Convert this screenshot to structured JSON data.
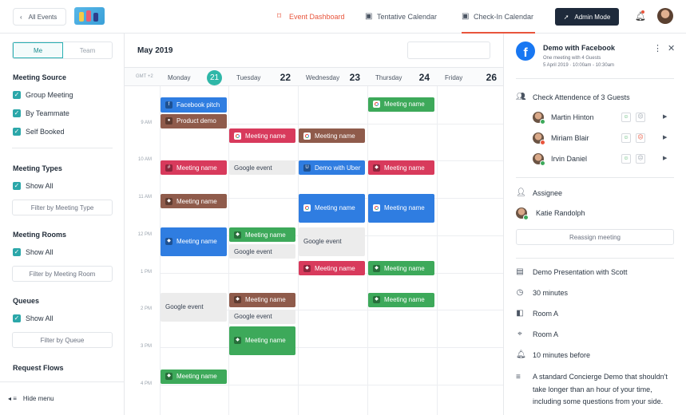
{
  "topbar": {
    "back_label": "All Events",
    "nav": [
      {
        "label": "Event Dashboard",
        "icon": "tag-icon"
      },
      {
        "label": "Tentative Calendar",
        "icon": "calendar-question-icon"
      },
      {
        "label": "Check-In Calendar",
        "icon": "calendar-check-icon"
      }
    ],
    "admin_label": "Admin Mode"
  },
  "sidebar": {
    "toggle": {
      "me": "Me",
      "team": "Team"
    },
    "meeting_source": {
      "title": "Meeting Source",
      "options": [
        "Group Meeting",
        "By Teammate",
        "Self Booked"
      ]
    },
    "meeting_types": {
      "title": "Meeting Types",
      "show_all": "Show All",
      "filter": "Filter by Meeting Type"
    },
    "meeting_rooms": {
      "title": "Meeting Rooms",
      "show_all": "Show All",
      "filter": "Filter by Meeting Room"
    },
    "queues": {
      "title": "Queues",
      "show_all": "Show All",
      "filter": "Filter by Queue"
    },
    "request_flows": {
      "title": "Request Flows"
    },
    "hide_menu": "Hide menu"
  },
  "calendar": {
    "month": "May 2019",
    "timezone": "GMT +2",
    "days": [
      {
        "name": "Monday",
        "num": "21",
        "today": true
      },
      {
        "name": "Tuesday",
        "num": "22"
      },
      {
        "name": "Wednesday",
        "num": "23"
      },
      {
        "name": "Thursday",
        "num": "24"
      },
      {
        "name": "Friday",
        "num": "26"
      }
    ],
    "times": [
      "9 AM",
      "10 AM",
      "11 AM",
      "12 PM",
      "1 PM",
      "2 PM",
      "3 PM",
      "4 PM"
    ],
    "events": [
      {
        "day": 0,
        "start": 8.25,
        "dur": 0.5,
        "label": "Facebook pitch",
        "color": "blue",
        "icon": "facebook-icon"
      },
      {
        "day": 0,
        "start": 8.7,
        "dur": 0.45,
        "label": "Product demo",
        "color": "brown",
        "icon": "zoom-icon"
      },
      {
        "day": 0,
        "start": 9.95,
        "dur": 0.45,
        "label": "Meeting name",
        "color": "red",
        "icon": "slack-icon"
      },
      {
        "day": 0,
        "start": 10.85,
        "dur": 0.45,
        "label": "Meeting name",
        "color": "brown",
        "icon": "app-icon"
      },
      {
        "day": 0,
        "start": 11.75,
        "dur": 0.85,
        "label": "Meeting name",
        "color": "blue",
        "icon": "app-icon"
      },
      {
        "day": 0,
        "start": 13.5,
        "dur": 0.85,
        "label": "Google event",
        "color": "gray"
      },
      {
        "day": 0,
        "start": 15.55,
        "dur": 0.45,
        "label": "Meeting name",
        "color": "green",
        "icon": "app-icon"
      },
      {
        "day": 1,
        "start": 9.1,
        "dur": 0.45,
        "label": "Meeting name",
        "color": "red",
        "icon": "google-icon"
      },
      {
        "day": 1,
        "start": 9.95,
        "dur": 0.45,
        "label": "Google event",
        "color": "gray"
      },
      {
        "day": 1,
        "start": 11.75,
        "dur": 0.45,
        "label": "Meeting name",
        "color": "green",
        "icon": "app-icon"
      },
      {
        "day": 1,
        "start": 12.2,
        "dur": 0.45,
        "label": "Google event",
        "color": "gray"
      },
      {
        "day": 1,
        "start": 13.5,
        "dur": 0.45,
        "label": "Meeting name",
        "color": "brown",
        "icon": "app-icon"
      },
      {
        "day": 1,
        "start": 13.95,
        "dur": 0.45,
        "label": "Google event",
        "color": "gray"
      },
      {
        "day": 1,
        "start": 14.4,
        "dur": 0.85,
        "label": "Meeting name",
        "color": "green",
        "icon": "app-icon"
      },
      {
        "day": 2,
        "start": 9.1,
        "dur": 0.45,
        "label": "Meeting name",
        "color": "brown",
        "icon": "google-icon"
      },
      {
        "day": 2,
        "start": 9.95,
        "dur": 0.45,
        "label": "Demo with Uber",
        "color": "blue",
        "icon": "uber-icon"
      },
      {
        "day": 2,
        "start": 10.85,
        "dur": 0.85,
        "label": "Meeting name",
        "color": "blue",
        "icon": "google-icon"
      },
      {
        "day": 2,
        "start": 11.75,
        "dur": 0.85,
        "label": "Google event",
        "color": "gray"
      },
      {
        "day": 2,
        "start": 12.65,
        "dur": 0.45,
        "label": "Meeting name",
        "color": "red",
        "icon": "app-icon"
      },
      {
        "day": 3,
        "start": 8.25,
        "dur": 0.45,
        "label": "Meeting name",
        "color": "green",
        "icon": "google-icon"
      },
      {
        "day": 3,
        "start": 9.95,
        "dur": 0.45,
        "label": "Meeting name",
        "color": "red",
        "icon": "app-icon"
      },
      {
        "day": 3,
        "start": 10.85,
        "dur": 0.85,
        "label": "Meeting name",
        "color": "blue",
        "icon": "google-icon"
      },
      {
        "day": 3,
        "start": 12.65,
        "dur": 0.45,
        "label": "Meeting name",
        "color": "green",
        "icon": "app-icon"
      },
      {
        "day": 3,
        "start": 13.5,
        "dur": 0.45,
        "label": "Meeting name",
        "color": "green",
        "icon": "app-icon"
      }
    ]
  },
  "panel": {
    "title": "Demo with Facebook",
    "subtitle": "One meeting with 4 Guests",
    "date": "5 April 2019 · 10:00am - 10:30am",
    "attendance_title": "Check Attendence of 3 Guests",
    "guests": [
      {
        "name": "Martin Hinton",
        "status": "#3da95a"
      },
      {
        "name": "Miriam Blair",
        "status": "#e8553c"
      },
      {
        "name": "Irvin Daniel",
        "status": "#3da95a"
      }
    ],
    "assignee_label": "Assignee",
    "assignee_name": "Katie Randolph",
    "reassign_label": "Reassign meeting",
    "details": [
      {
        "icon": "document-icon",
        "text": "Demo Presentation with Scott"
      },
      {
        "icon": "clock-icon",
        "text": "30 minutes"
      },
      {
        "icon": "door-icon",
        "text": "Room A"
      },
      {
        "icon": "location-pin-icon",
        "text": "Room A"
      },
      {
        "icon": "bell-icon",
        "text": "10 minutes before"
      }
    ],
    "description": "A standard Concierge Demo that shouldn't take longer than an hour of your time, including some questions from your side."
  }
}
